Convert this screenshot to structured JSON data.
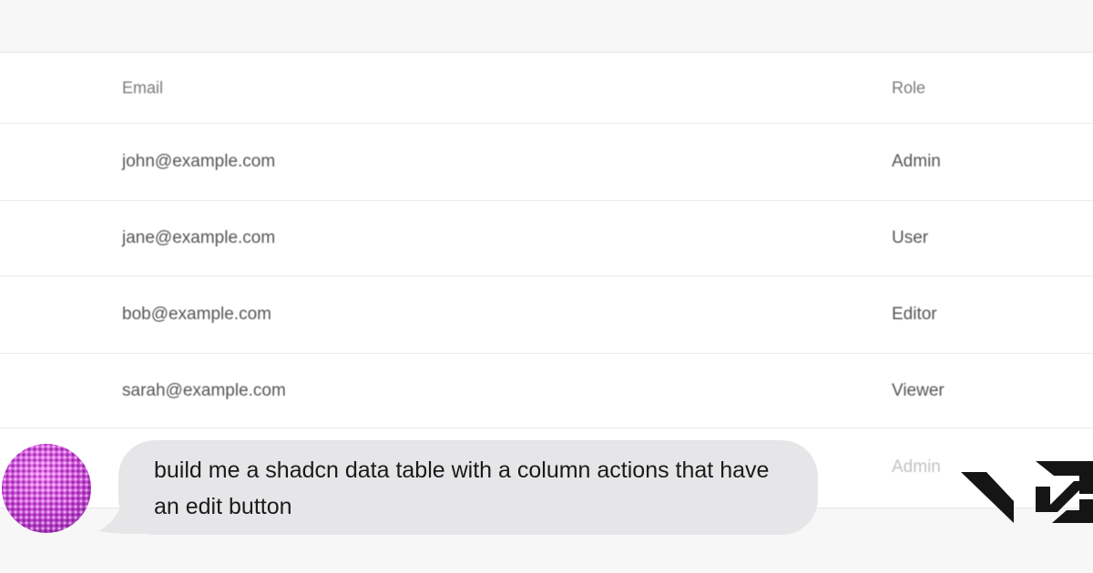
{
  "table": {
    "headers": {
      "email": "Email",
      "role": "Role"
    },
    "rows": [
      {
        "email": "john@example.com",
        "role": "Admin"
      },
      {
        "email": "jane@example.com",
        "role": "User"
      },
      {
        "email": "bob@example.com",
        "role": "Editor"
      },
      {
        "email": "sarah@example.com",
        "role": "Viewer"
      },
      {
        "email": "",
        "role": "Admin"
      }
    ]
  },
  "chat": {
    "avatar_icon": "user-avatar-icon",
    "message": "build me a shadcn data table with a column actions that have an edit button",
    "bubble_color": "#e6e6e8"
  },
  "logo": {
    "icon": "v0-logo-icon"
  }
}
